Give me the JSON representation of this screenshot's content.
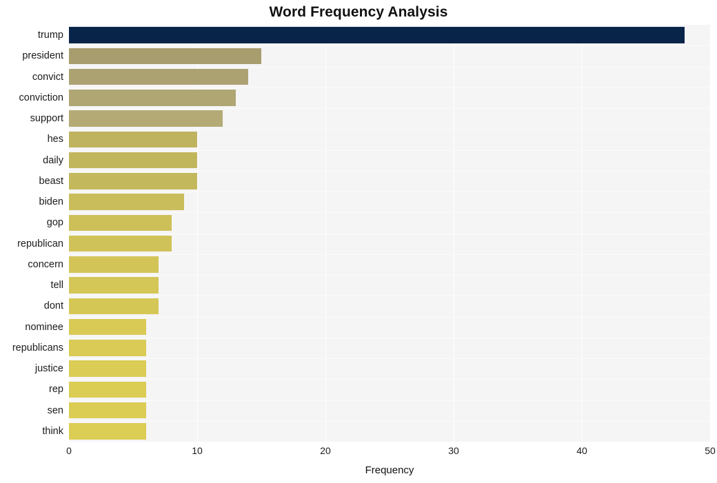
{
  "chart_data": {
    "type": "bar",
    "orientation": "horizontal",
    "title": "Word Frequency Analysis",
    "xlabel": "Frequency",
    "ylabel": "",
    "categories": [
      "trump",
      "president",
      "convict",
      "conviction",
      "support",
      "hes",
      "daily",
      "beast",
      "biden",
      "gop",
      "republican",
      "concern",
      "tell",
      "dont",
      "nominee",
      "republicans",
      "justice",
      "rep",
      "sen",
      "think"
    ],
    "values": [
      48,
      15,
      14,
      13,
      12,
      10,
      10,
      10,
      9,
      8,
      8,
      7,
      7,
      7,
      6,
      6,
      6,
      6,
      6,
      6
    ],
    "xlim": [
      0,
      50
    ],
    "xticks": [
      "0",
      "10",
      "20",
      "30",
      "40",
      "50"
    ],
    "xtick_values": [
      0,
      10,
      20,
      30,
      40,
      50
    ],
    "grid": true,
    "grid_axis": "x",
    "legend": false,
    "bar_colors": [
      "#082549",
      "#a89d6e",
      "#aca271",
      "#b0a673",
      "#b4aa75",
      "#bfb35f",
      "#c2b65d",
      "#c4b85c",
      "#c9bc5b",
      "#cdc059",
      "#cfc258",
      "#d2c457",
      "#d4c657",
      "#d5c756",
      "#d8ca55",
      "#d9cb55",
      "#dacc55",
      "#dbcd54",
      "#dbcd54",
      "#dccd54"
    ],
    "plot_background": "#f5f5f6",
    "grid_color": "#ffffff",
    "title_color": "#111111",
    "tick_label_color": "#1b1b1b"
  }
}
